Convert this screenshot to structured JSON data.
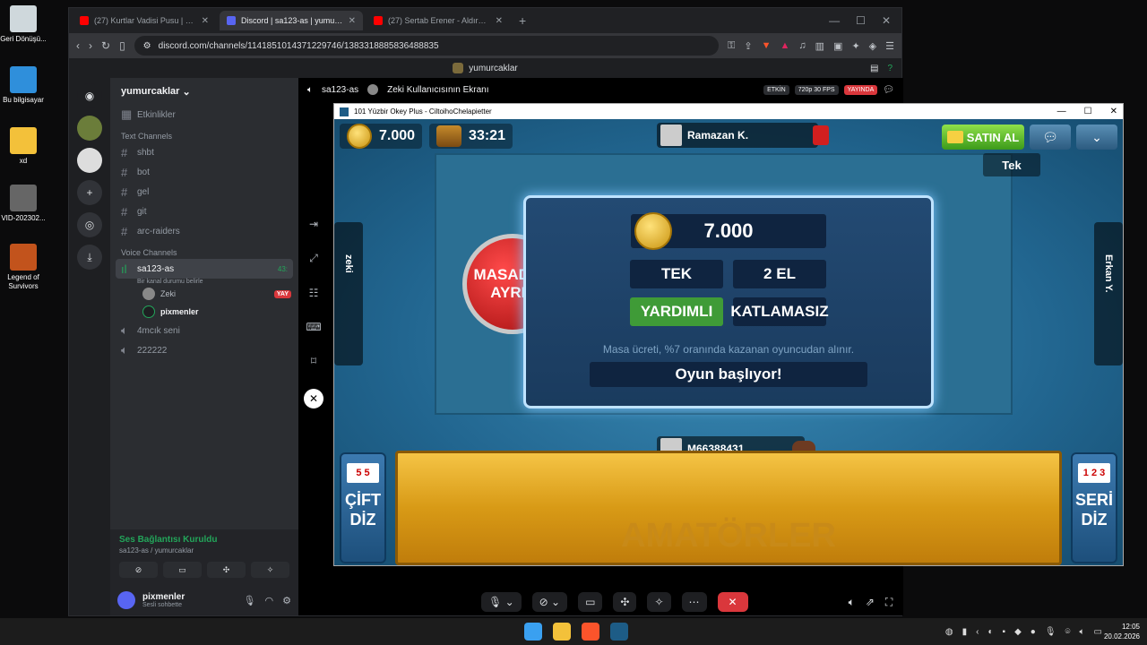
{
  "desktop": {
    "icons": [
      "Geri Dönüşü...",
      "Bu bilgisayar",
      "xd",
      "VID-202302...",
      "Legend of Survivors"
    ]
  },
  "browser": {
    "tabs": [
      {
        "label": "(27) Kurtlar Vadisi Pusu | 152. Bölüm",
        "color": "#ff0000"
      },
      {
        "label": "Discord | sa123-as | yumurcaklar",
        "color": "#5865f2"
      },
      {
        "label": "(27) Sertab Erener - Aldırma Deli",
        "color": "#ff0000"
      }
    ],
    "url": "discord.com/channels/1141851014371229746/1383318885836488835"
  },
  "discord": {
    "title": "yumurcaklar",
    "guild_name": "yumurcaklar",
    "events": "Etkinlikler",
    "text_category": "Text Channels",
    "text_channels": [
      "shbt",
      "bot",
      "gel",
      "git",
      "arc-raiders"
    ],
    "voice_category": "Voice Channels",
    "active_voice": {
      "name": "sa123-as",
      "time": "43:",
      "status": "Bir kanal durumu belirle"
    },
    "voice_users": [
      {
        "name": "Zeki",
        "badge": "YAY"
      },
      {
        "name": "pixmenler"
      }
    ],
    "voice_channels": [
      "4mcık seni",
      "222222"
    ],
    "connection": {
      "status": "Ses Bağlantısı Kuruldu",
      "sub": "sa123-as / yumurcaklar"
    },
    "user": {
      "name": "pixmenler",
      "sub": "Sesli sohbette"
    },
    "stream_header": {
      "channel": "sa123-as",
      "screen": "Zeki Kullanıcısının Ekranı",
      "etkin": "ETKİN",
      "quality": "720p 30 FPS",
      "live": "YAYINDA"
    }
  },
  "game": {
    "window_title": "101 Yüzbir Okey Plus - CiltoihoChelapietter",
    "coins": "7.000",
    "timer": "33:21",
    "top_player": "Ramazan K.",
    "buy_label": "SATIN AL",
    "tek_badge": "Tek",
    "left_player": "zeki",
    "right_player": "Erkan Y.",
    "bottom_player": "M66388431",
    "leave_label_1": "MASADAN",
    "leave_label_2": "AYRIL",
    "dialog": {
      "amount": "7.000",
      "opt1": "TEK",
      "opt2": "2 EL",
      "opt3": "YARDIMLI",
      "opt4": "KATLAMASIZ",
      "note": "Masa ücreti, %7 oranında kazanan oyuncudan alınır.",
      "status": "Oyun başlıyor!"
    },
    "rack_label": "AMATÖRLER",
    "left_button": [
      "ÇİFT",
      "DİZ"
    ],
    "left_tiles": "5 5",
    "right_button": [
      "SERİ",
      "DİZ"
    ],
    "right_tiles": "1 2 3"
  },
  "taskbar": {
    "time": "12:05",
    "date": "20.02.2026"
  }
}
